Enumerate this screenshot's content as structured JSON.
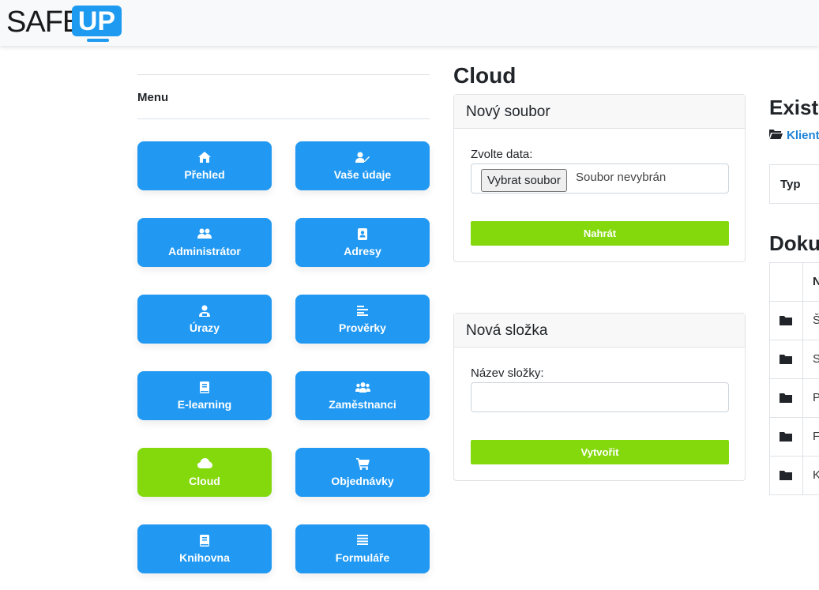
{
  "logo": {
    "part1": "SAFE",
    "part2": "UP"
  },
  "menu": {
    "title": "Menu",
    "items": [
      {
        "label": "Přehled",
        "icon": "home-icon"
      },
      {
        "label": "Vaše údaje",
        "icon": "user-edit-icon"
      },
      {
        "label": "Administrátor",
        "icon": "users-icon"
      },
      {
        "label": "Adresy",
        "icon": "address-book-icon"
      },
      {
        "label": "Úrazy",
        "icon": "user-injured-icon"
      },
      {
        "label": "Prověrky",
        "icon": "align-left-icon"
      },
      {
        "label": "E-learning",
        "icon": "book-icon"
      },
      {
        "label": "Zaměstnanci",
        "icon": "users-group-icon"
      },
      {
        "label": "Cloud",
        "icon": "cloud-icon",
        "active": true
      },
      {
        "label": "Objednávky",
        "icon": "shopping-cart-icon"
      },
      {
        "label": "Knihovna",
        "icon": "book-icon"
      },
      {
        "label": "Formuláře",
        "icon": "list-icon"
      }
    ]
  },
  "cloud": {
    "heading": "Cloud",
    "upload": {
      "title": "Nový soubor",
      "label": "Zvolte data:",
      "choose_button": "Vybrat soubor",
      "no_file": "Soubor nevybrán",
      "submit": "Nahrát"
    },
    "folder": {
      "title": "Nová složka",
      "label": "Název složky:",
      "value": "",
      "submit": "Vytvořit"
    }
  },
  "right": {
    "heading1": "Existu",
    "breadcrumb": "Klient",
    "table1_header": "Typ",
    "heading2": "Doku",
    "table2_header": "N",
    "rows": [
      "Š",
      "S",
      "P",
      "F",
      "K"
    ]
  },
  "colors": {
    "blue": "#2199f3",
    "green": "#84d90c",
    "brand": "#1e9af0"
  }
}
